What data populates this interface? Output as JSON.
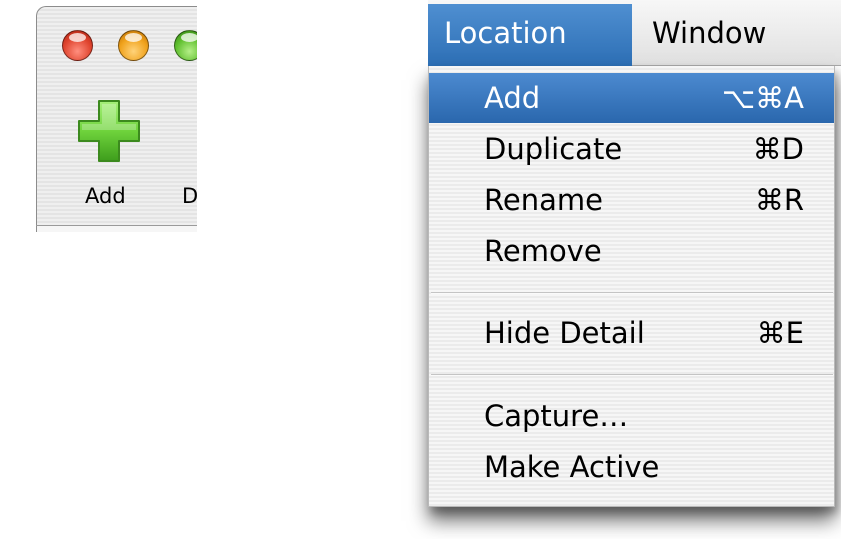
{
  "toolbar": {
    "add_label": "Add",
    "next_label": "D",
    "traffic_lights": [
      "close",
      "minimize",
      "zoom"
    ]
  },
  "menubar": {
    "items": [
      {
        "label": "Location",
        "active": true
      },
      {
        "label": "Window",
        "active": false
      }
    ]
  },
  "menu": {
    "items": [
      {
        "label": "Add",
        "shortcut": "⌥⌘A",
        "highlighted": true
      },
      {
        "label": "Duplicate",
        "shortcut": "⌘D"
      },
      {
        "label": "Rename",
        "shortcut": "⌘R"
      },
      {
        "label": "Remove",
        "shortcut": ""
      },
      {
        "label": "Hide Detail",
        "shortcut": "⌘E"
      },
      {
        "label": "Capture…",
        "shortcut": ""
      },
      {
        "label": "Make Active",
        "shortcut": ""
      }
    ]
  },
  "colors": {
    "selection": "#2f6fb5",
    "add_icon_green": "#6fd33c"
  }
}
